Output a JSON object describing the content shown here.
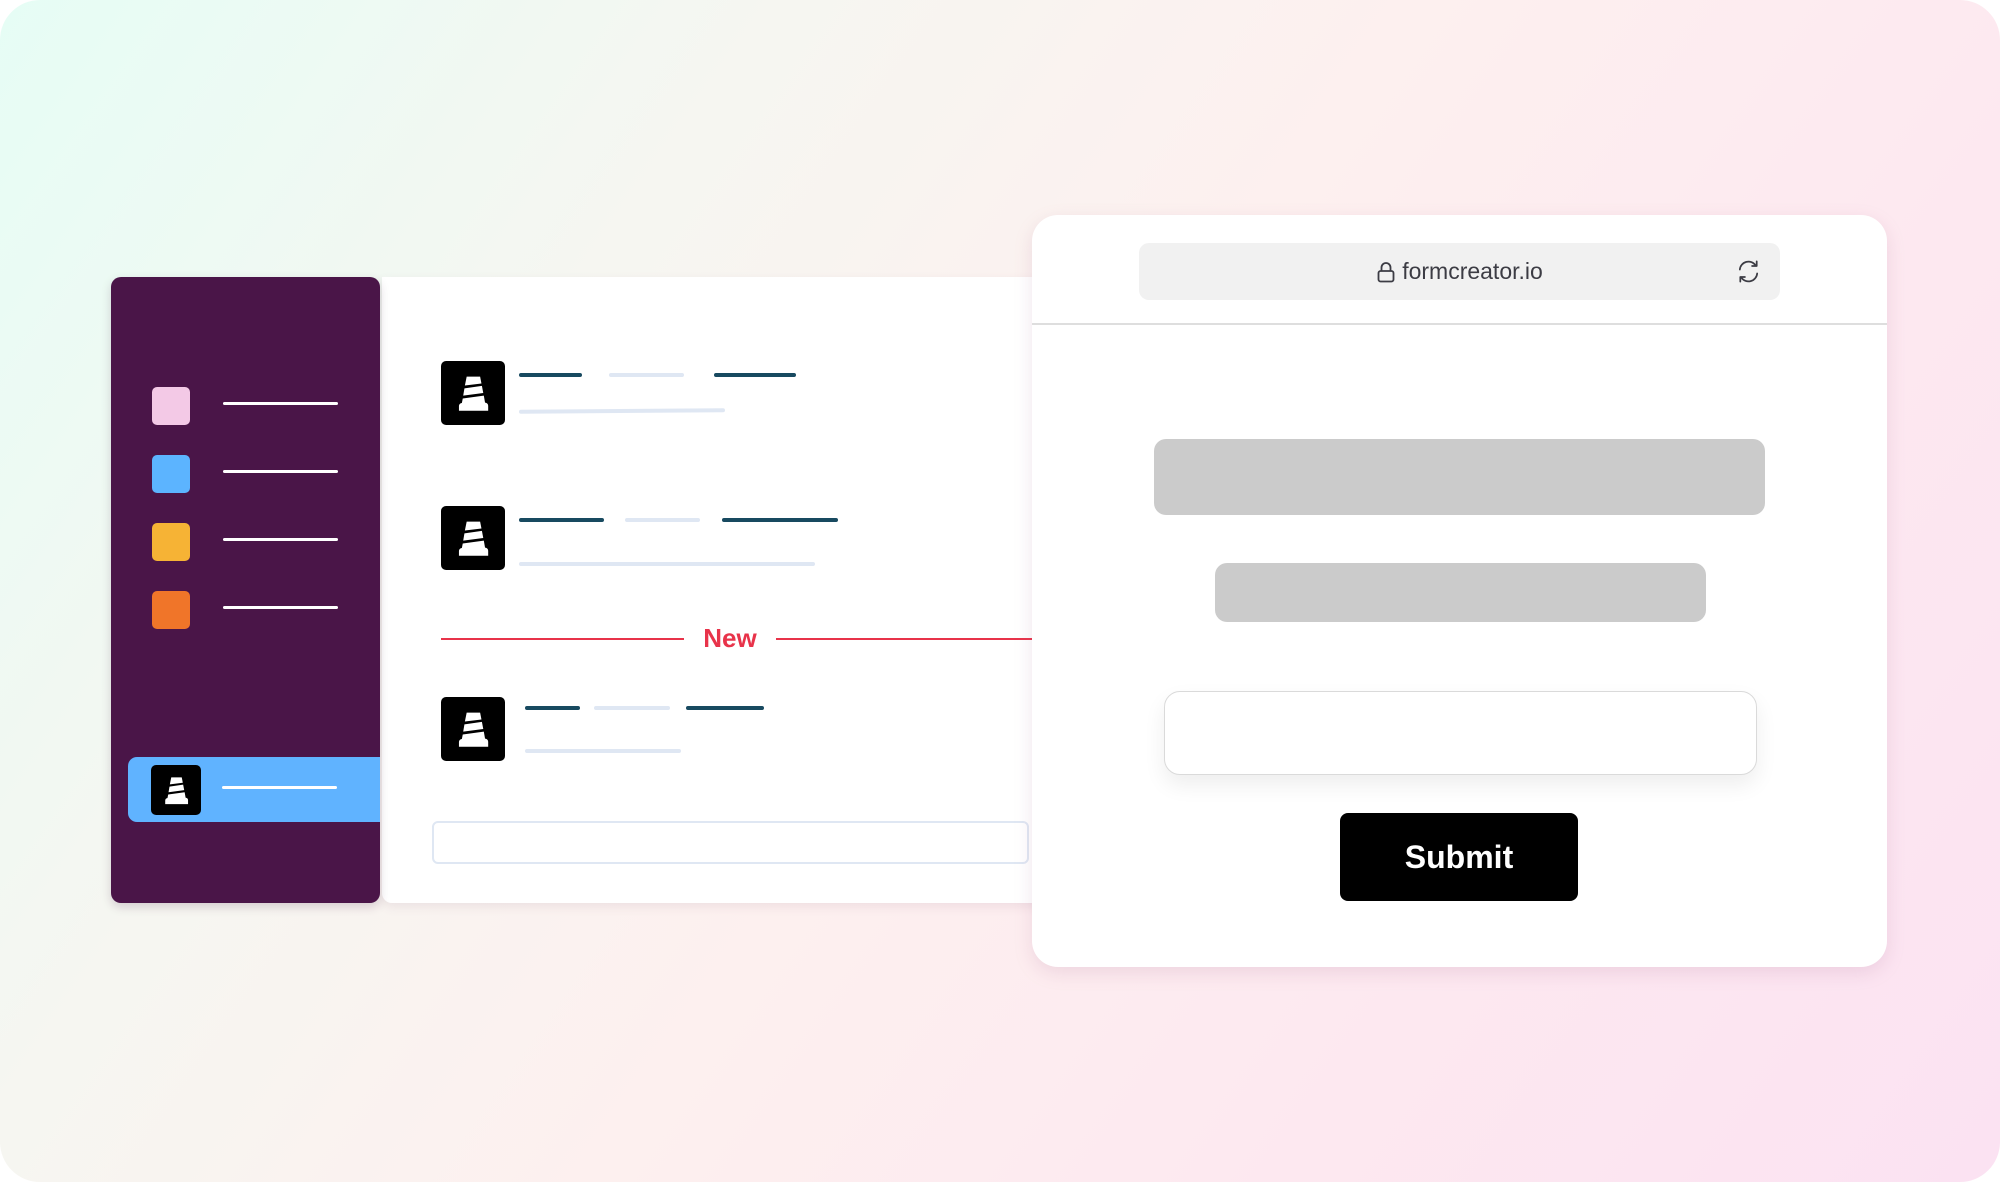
{
  "colors": {
    "sidebar_bg": "#4a1548",
    "active_item": "#60b3ff",
    "new_divider": "#e8334a",
    "message_bar_dark": "#184a60",
    "message_bar_light": "#dfe7f3",
    "placeholder_block": "#cbcbcb",
    "submit_bg": "#000000"
  },
  "sidebar": {
    "items": [
      {
        "swatch_color": "#f3c9e6",
        "icon": "pink-square-icon"
      },
      {
        "swatch_color": "#5cb4ff",
        "icon": "blue-square-icon"
      },
      {
        "swatch_color": "#f6b335",
        "icon": "yellow-square-icon"
      },
      {
        "swatch_color": "#f07529",
        "icon": "orange-square-icon"
      }
    ],
    "active_item": {
      "icon": "traffic-cone-app-icon",
      "selected": true
    }
  },
  "chat": {
    "messages": [
      {
        "avatar_icon": "traffic-cone-app-icon"
      },
      {
        "avatar_icon": "traffic-cone-app-icon"
      },
      {
        "avatar_icon": "traffic-cone-app-icon"
      }
    ],
    "new_divider_label": "New",
    "message_input": {
      "value": "",
      "placeholder": ""
    }
  },
  "browser": {
    "url": "formcreator.io",
    "lock_icon": "lock-icon",
    "reload_icon": "reload-icon",
    "form": {
      "input_value": "",
      "submit_label": "Submit"
    }
  }
}
